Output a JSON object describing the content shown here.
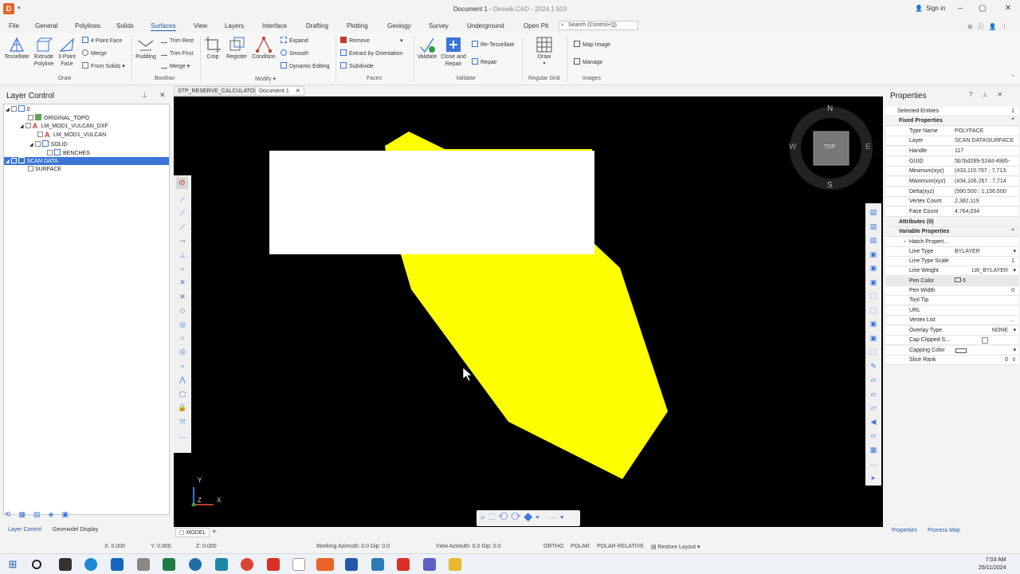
{
  "window": {
    "title_doc": "Document 1",
    "title_app": "Deswik.CAD",
    "title_version": "2024.1.503",
    "signin_label": "Sign in"
  },
  "menu": {
    "tabs": [
      "File",
      "General",
      "Polylines",
      "Solids",
      "Surfaces",
      "View",
      "Layers",
      "Interface",
      "Drafting",
      "Plotting",
      "Geology",
      "Survey",
      "Underground",
      "Open Pit"
    ],
    "active_tab": "Surfaces",
    "search_placeholder": "Search (Control+Q)"
  },
  "ribbon": {
    "draw": {
      "tessellate": "Tessellate",
      "extrude_polyline": "Extrude Polyline",
      "three_point_face": "3 Point Face",
      "four_point_face": "4 Point Face",
      "merge": "Merge",
      "from_solids": "From Solids",
      "group": "Draw"
    },
    "boolean": {
      "pudding": "Pudding",
      "trim_rest": "Trim Rest",
      "trim_first": "Trim First",
      "merge": "Merge",
      "group": "Boolean"
    },
    "modify": {
      "crop": "Crop",
      "register": "Register",
      "condition": "Condition",
      "expand": "Expand",
      "smooth": "Smooth",
      "dynamic_editing": "Dynamic Editing",
      "group": "Modify"
    },
    "faces": {
      "remove": "Remove",
      "extract_by_orientation": "Extract by Orientation",
      "subdivide": "Subdivide",
      "group": "Faces"
    },
    "validate": {
      "validate": "Validate",
      "close_and_repair": "Close and Repair",
      "re_tessellate": "Re-Tessellate",
      "repair": "Repair",
      "group": "Validate"
    },
    "regular_grid": {
      "draw": "Draw",
      "group": "Regular Grid"
    },
    "images": {
      "map_image": "Map Image",
      "manage": "Manage",
      "group": "Images"
    }
  },
  "layer_control": {
    "title": "Layer Control",
    "nodes": [
      {
        "label": "0"
      },
      {
        "label": "ORIGINAL_TOPO"
      },
      {
        "label": "LM_MOD1_VULCAN_DXF"
      },
      {
        "label": "LM_MOD1_VULCAN"
      },
      {
        "label": "SOLID"
      },
      {
        "label": "BENCHES"
      },
      {
        "label": "SCAN DATA"
      },
      {
        "label": "SURFACE"
      }
    ],
    "bottom_tabs": [
      "Layer Control",
      "Geomodel Display"
    ]
  },
  "documents": {
    "tabs": [
      "STP_RESERVE_CALCULATOR",
      "Document 1"
    ],
    "active": "Document 1"
  },
  "viewport": {
    "compass": {
      "n": "N",
      "s": "S",
      "e": "E",
      "w": "W",
      "face": "TOP"
    },
    "axes": {
      "y": "Y",
      "z": "Z",
      "x": "X"
    },
    "shape_color": "#ffff00",
    "model_tab": "MODEL"
  },
  "properties": {
    "title": "Properties",
    "selected_entities_label": "Selected Entities",
    "selected_entities_value": "1",
    "fixed_header": "Fixed Properties",
    "fixed": [
      {
        "k": "Type Name",
        "v": "POLYFACE"
      },
      {
        "k": "Layer",
        "v": "SCAN DATA\\SURFACE"
      },
      {
        "k": "Handle",
        "v": "117"
      },
      {
        "k": "GUID",
        "v": "5b7bd289-524d-4985-"
      },
      {
        "k": "Minimum(xyz)",
        "v": "(433,115.767 ; 7,713"
      },
      {
        "k": "Maximum(xyz)",
        "v": "(434,106.267 ; 7,714"
      },
      {
        "k": "Delta(xyz)",
        "v": "(990.500 ; 1,156.500"
      },
      {
        "k": "Vertex Count",
        "v": "2,382,119"
      },
      {
        "k": "Face Count",
        "v": "4,764,034"
      }
    ],
    "attributes_header": "Attributes (0)",
    "variable_header": "Variable Properties",
    "variable": [
      {
        "k": "Hatch Propert...",
        "v": ""
      },
      {
        "k": "Line Type",
        "v": "BYLAYER"
      },
      {
        "k": "Line Type Scale",
        "v": "1"
      },
      {
        "k": "Line Weight",
        "v": "LW_BYLAYER"
      },
      {
        "k": "Pen Color",
        "v": "6"
      },
      {
        "k": "Pen Width",
        "v": "0"
      },
      {
        "k": "Tool Tip",
        "v": ""
      },
      {
        "k": "URL",
        "v": ""
      },
      {
        "k": "Vertex List",
        "v": "..."
      },
      {
        "k": "Overlay Type",
        "v": "NONE"
      },
      {
        "k": "Cap Clipped S...",
        "v": ""
      },
      {
        "k": "Capping Color",
        "v": ""
      },
      {
        "k": "Slice Rank",
        "v": "0"
      }
    ],
    "bottom_tabs": [
      "Properties",
      "Process Map"
    ]
  },
  "status": {
    "x": "X: 0.000",
    "y": "Y: 0.000",
    "z": "Z: 0.000",
    "working_azimuth": "Working Azimuth: 0.0 Dip: 0.0",
    "view_azimuth": "View Azimuth: 0.0 Dip: 0.0",
    "ortho": "ORTHO",
    "polar": "POLAR",
    "polar_relative": "POLAR RELATIVE",
    "restore_layout": "Restore Layout"
  },
  "taskbar": {
    "time": "7:03 AM",
    "date": "25/11/2024"
  }
}
